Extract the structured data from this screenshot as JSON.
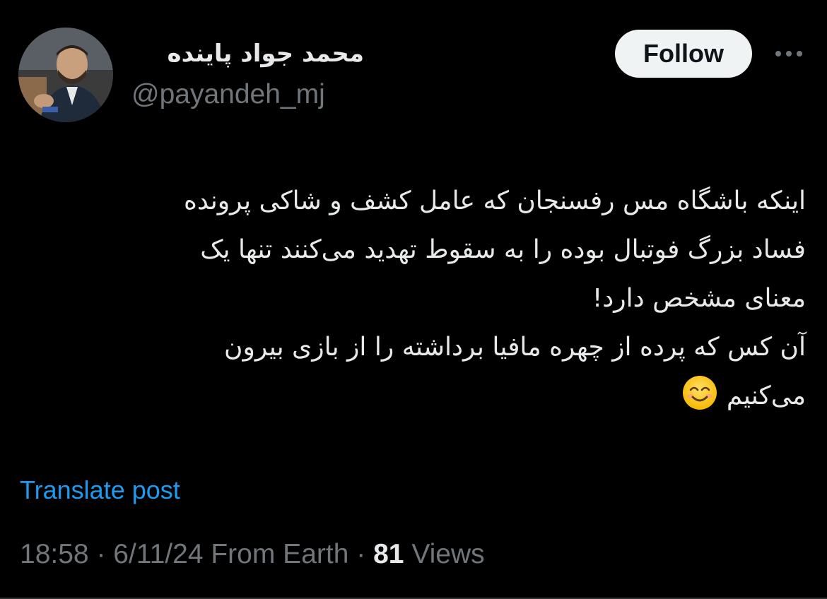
{
  "author": {
    "display_name": "محمد جواد پاینده",
    "handle": "@payandeh_mj",
    "avatar_icon": "profile-photo"
  },
  "actions": {
    "follow_label": "Follow",
    "more_icon": "more-dots-icon"
  },
  "tweet": {
    "lines": [
      "اینکه باشگاه مس رفسنجان که عامل کشف و شاکی پرونده",
      "فساد بزرگ فوتبال بوده را به سقوط تهدید می‌کنند تنها یک",
      "معنای مشخص دارد!",
      "آن کس که پرده از چهره مافیا برداشته را از بازی بیرون",
      "می‌کنیم"
    ],
    "emoji": "😊"
  },
  "translate_label": "Translate post",
  "meta": {
    "time": "18:58",
    "separator": " · ",
    "date": "6/11/24",
    "source": "From Earth",
    "views_count": "81",
    "views_label": "Views"
  },
  "colors": {
    "background": "#000000",
    "text_primary": "#e7e9ea",
    "text_secondary": "#71767b",
    "link": "#1d9bf0",
    "follow_bg": "#eff3f4"
  }
}
